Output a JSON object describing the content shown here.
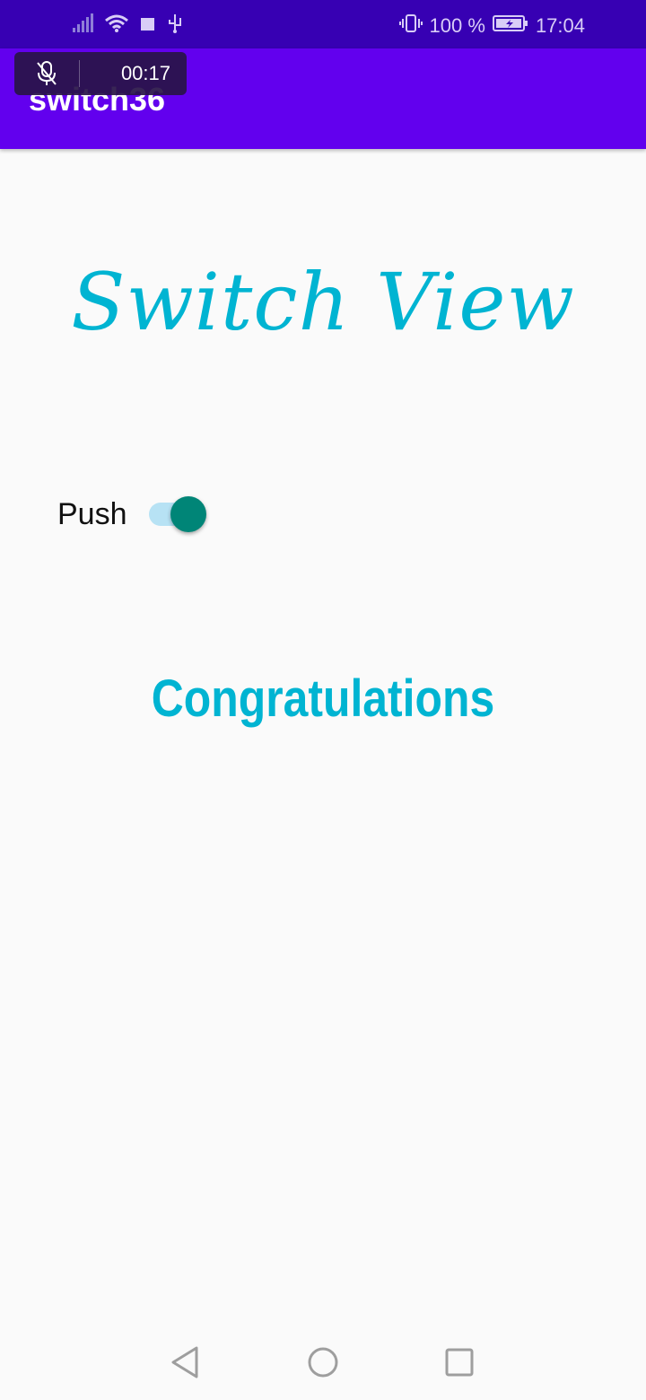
{
  "status_bar": {
    "battery": "100 %",
    "time": "17:04",
    "icons": [
      "signal-icon",
      "wifi-icon",
      "notification-square-icon",
      "usb-icon",
      "vibrate-icon",
      "battery-icon"
    ]
  },
  "recording": {
    "timer": "00:17",
    "icon": "mic-off-icon"
  },
  "app_bar": {
    "title": "switch36"
  },
  "main": {
    "headline": "Switch View",
    "switch": {
      "label": "Push",
      "checked": true
    },
    "message": "Congratulations"
  },
  "colors": {
    "status_bar": "#3700b3",
    "app_bar": "#6200ee",
    "accent_text": "#00b4d2",
    "switch_thumb": "#008577",
    "switch_track": "#b7e2f4"
  },
  "nav": {
    "items": [
      "back-icon",
      "home-icon",
      "recents-icon"
    ]
  }
}
